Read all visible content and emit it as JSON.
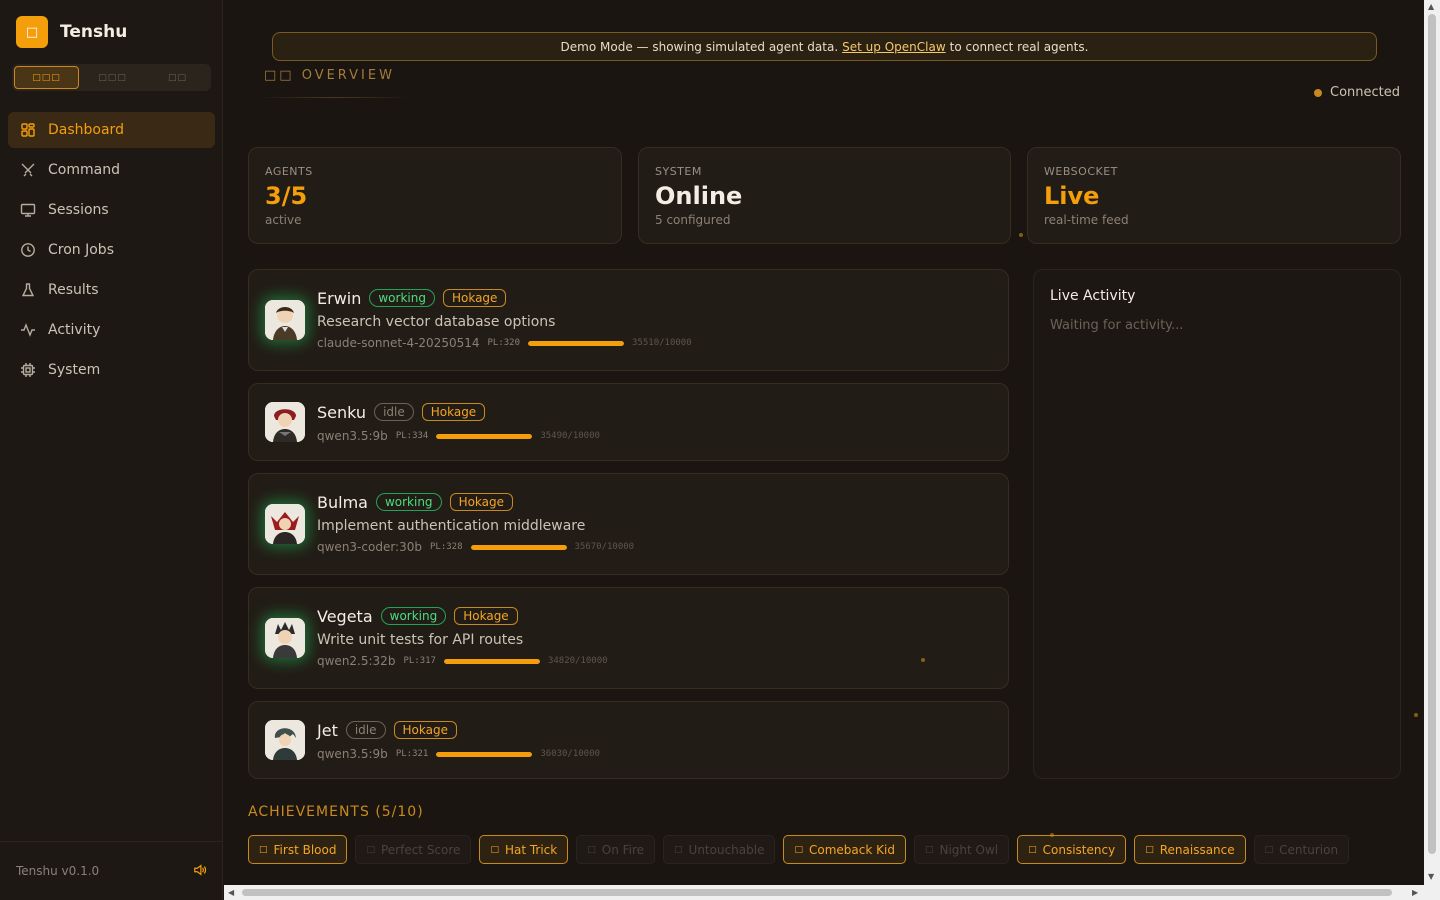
{
  "brand": {
    "name": "Tenshu",
    "logo_icon": "shield-icon"
  },
  "lang_switch": {
    "options": [
      "□□□",
      "□□□",
      "□□"
    ],
    "active": 0
  },
  "nav": {
    "items": [
      {
        "label": "Dashboard",
        "icon": "grid-icon",
        "active": true
      },
      {
        "label": "Command",
        "icon": "crossed-swords-icon",
        "active": false
      },
      {
        "label": "Sessions",
        "icon": "monitor-icon",
        "active": false
      },
      {
        "label": "Cron Jobs",
        "icon": "clock-icon",
        "active": false
      },
      {
        "label": "Results",
        "icon": "flask-icon",
        "active": false
      },
      {
        "label": "Activity",
        "icon": "pulse-icon",
        "active": false
      },
      {
        "label": "System",
        "icon": "chip-icon",
        "active": false
      }
    ]
  },
  "footer": {
    "version": "Tenshu v0.1.0",
    "sound_icon": "speaker-icon"
  },
  "banner": {
    "text_before": "Demo Mode — showing simulated agent data.",
    "link": "Set up OpenClaw",
    "text_after": "to connect real agents."
  },
  "header": {
    "overview_label": "□□  OVERVIEW",
    "connection_status": "Connected"
  },
  "stats": [
    {
      "label": "AGENTS",
      "value": "3/5",
      "sub": "active",
      "accent": true
    },
    {
      "label": "SYSTEM",
      "value": "Online",
      "sub": "5 configured",
      "accent": false
    },
    {
      "label": "WEBSOCKET",
      "value": "Live",
      "sub": "real-time feed",
      "accent": true
    }
  ],
  "agents": [
    {
      "name": "Erwin",
      "status": "working",
      "rank": "Hokage",
      "task": "Research vector database options",
      "model": "claude-sonnet-4-20250514",
      "pl": "PL:320",
      "xp": "35510/10000"
    },
    {
      "name": "Senku",
      "status": "idle",
      "rank": "Hokage",
      "task": "",
      "model": "qwen3.5:9b",
      "pl": "PL:334",
      "xp": "35490/10000"
    },
    {
      "name": "Bulma",
      "status": "working",
      "rank": "Hokage",
      "task": "Implement authentication middleware",
      "model": "qwen3-coder:30b",
      "pl": "PL:328",
      "xp": "35670/10000"
    },
    {
      "name": "Vegeta",
      "status": "working",
      "rank": "Hokage",
      "task": "Write unit tests for API routes",
      "model": "qwen2.5:32b",
      "pl": "PL:317",
      "xp": "34820/10000"
    },
    {
      "name": "Jet",
      "status": "idle",
      "rank": "Hokage",
      "task": "",
      "model": "qwen3.5:9b",
      "pl": "PL:321",
      "xp": "36030/10000"
    }
  ],
  "activity": {
    "title": "Live Activity",
    "empty": "Waiting for activity..."
  },
  "achievements": {
    "title": "ACHIEVEMENTS (5/10)",
    "items": [
      {
        "label": "First Blood",
        "unlocked": true
      },
      {
        "label": "Perfect Score",
        "unlocked": false
      },
      {
        "label": "Hat Trick",
        "unlocked": true
      },
      {
        "label": "On Fire",
        "unlocked": false
      },
      {
        "label": "Untouchable",
        "unlocked": false
      },
      {
        "label": "Comeback Kid",
        "unlocked": true
      },
      {
        "label": "Night Owl",
        "unlocked": false
      },
      {
        "label": "Consistency",
        "unlocked": true
      },
      {
        "label": "Renaissance",
        "unlocked": true
      },
      {
        "label": "Centurion",
        "unlocked": false
      }
    ]
  },
  "colors": {
    "accent": "#f59e0b",
    "working": "#4ade80",
    "background": "#1a1510"
  }
}
